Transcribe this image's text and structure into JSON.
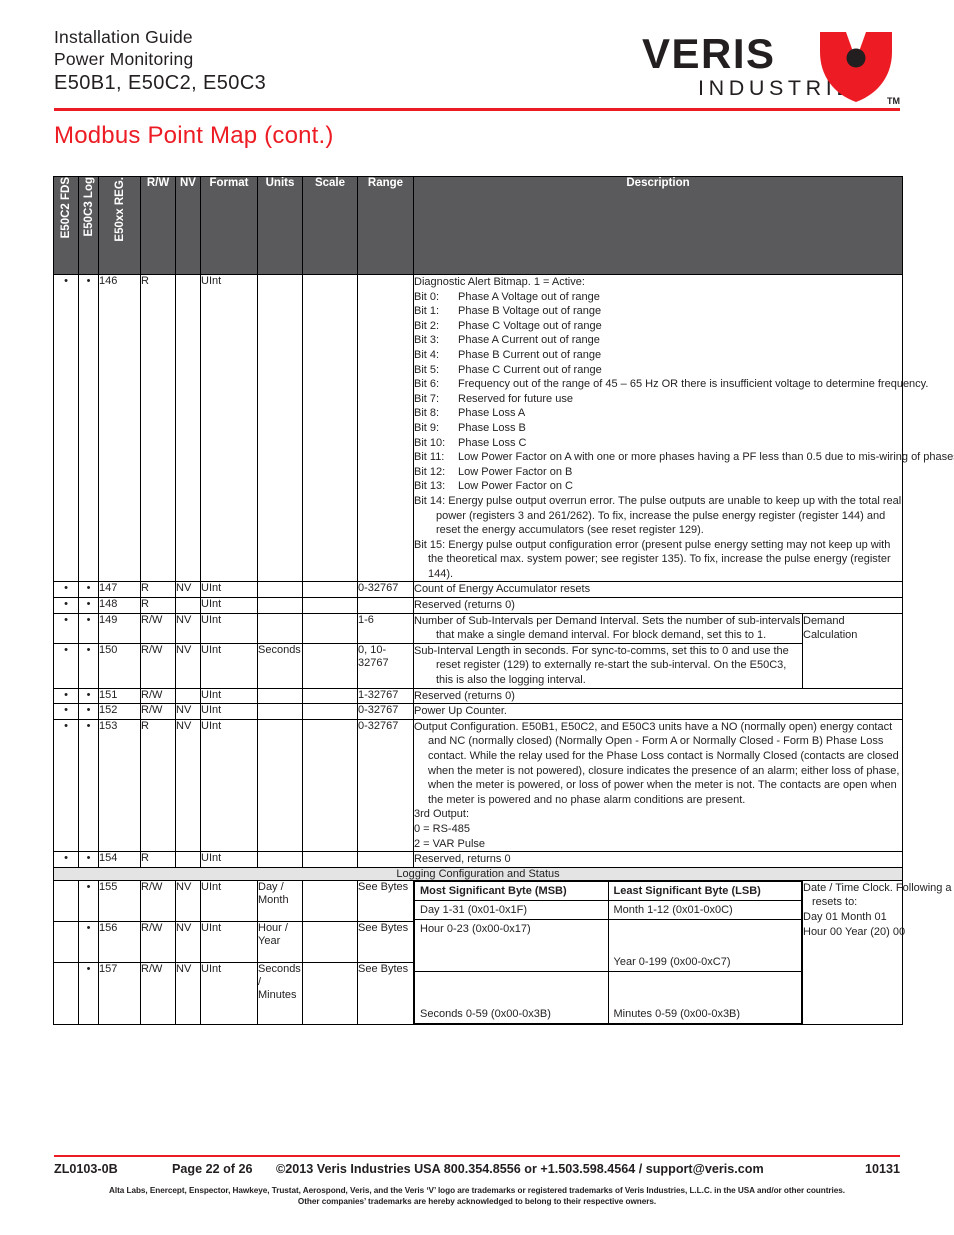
{
  "header": {
    "line1": "Installation Guide",
    "line2": "Power Monitoring",
    "line3": "E50B1, E50C2, E50C3",
    "logo_name": "VERIS",
    "logo_sub": "INDUSTRIES",
    "logo_tm": "TM",
    "page_title": "Modbus Point Map (cont.)"
  },
  "colors": {
    "accent_red": "#ed1c24",
    "header_gray": "#5a595b",
    "band_gray": "#e4e4e4",
    "text": "#231f20"
  },
  "table": {
    "columns": [
      "E50C2 FDS",
      "E50C3 Log",
      "E50xx REG.",
      "R/W",
      "NV",
      "Format",
      "Units",
      "Scale",
      "Range",
      "Description"
    ],
    "rows": [
      {
        "fds": "•",
        "log": "•",
        "reg": "146",
        "rw": "R",
        "nv": "",
        "format": "UInt",
        "units": "",
        "scale": "",
        "range": "",
        "desc_title": "Diagnostic Alert Bitmap. 1 = Active:",
        "bits": [
          {
            "label": "Bit 0:",
            "text": "Phase A Voltage out of range"
          },
          {
            "label": "Bit 1:",
            "text": "Phase B Voltage out of range"
          },
          {
            "label": "Bit 2:",
            "text": "Phase C Voltage out of range"
          },
          {
            "label": "Bit 3:",
            "text": "Phase A Current out of range"
          },
          {
            "label": "Bit 4:",
            "text": "Phase B Current out of range"
          },
          {
            "label": "Bit 5:",
            "text": "Phase C Current out of range"
          },
          {
            "label": "Bit 6:",
            "text": "Frequency out of the range of 45 – 65 Hz OR there is insufficient voltage to determine frequency."
          },
          {
            "label": "Bit 7:",
            "text": "Reserved for future use"
          },
          {
            "label": "Bit 8:",
            "text": "Phase Loss A"
          },
          {
            "label": "Bit 9:",
            "text": "Phase Loss B"
          },
          {
            "label": "Bit 10:",
            "text": "Phase Loss C"
          },
          {
            "label": "Bit 11:",
            "text": "Low Power Factor on A with one or more phases having a PF less than 0.5 due to mis-wiring of phases"
          },
          {
            "label": "Bit 12:",
            "text": "Low Power Factor on B"
          },
          {
            "label": "Bit 13:",
            "text": "Low Power Factor on C"
          }
        ],
        "bit14": "Bit 14:  Energy pulse output overrun error. The pulse outputs are unable to keep up with the total real power (registers 3 and 261/262). To fix, increase the pulse energy register (register 144) and reset the energy accumulators (see reset register 129).",
        "bit15": "Bit 15:  Energy pulse output configuration error (present pulse energy setting may not keep up with the theoretical max. system power; see register 135). To fix, increase the pulse energy (register 144)."
      },
      {
        "fds": "•",
        "log": "•",
        "reg": "147",
        "rw": "R",
        "nv": "NV",
        "format": "UInt",
        "units": "",
        "scale": "",
        "range": "0-32767",
        "desc": "Count of Energy Accumulator resets"
      },
      {
        "fds": "•",
        "log": "•",
        "reg": "148",
        "rw": "R",
        "nv": "",
        "format": "UInt",
        "units": "",
        "scale": "",
        "range": "",
        "desc": "Reserved (returns 0)"
      },
      {
        "fds": "•",
        "log": "•",
        "reg": "149",
        "rw": "R/W",
        "nv": "NV",
        "format": "UInt",
        "units": "",
        "scale": "",
        "range": "1-6",
        "desc": "Number of Sub-Intervals per Demand Interval. Sets the number of sub-intervals that make a single demand interval. For block demand, set this to 1.",
        "group": "Demand Calculation"
      },
      {
        "fds": "•",
        "log": "•",
        "reg": "150",
        "rw": "R/W",
        "nv": "NV",
        "format": "UInt",
        "units": "Seconds",
        "scale": "",
        "range": "0, 10-32767",
        "desc": "Sub-Interval Length in seconds. For sync-to-comms, set this to 0 and use the reset register (129) to externally re-start the sub-interval. On the E50C3, this is also the logging interval."
      },
      {
        "fds": "•",
        "log": "•",
        "reg": "151",
        "rw": "R/W",
        "nv": "",
        "format": "UInt",
        "units": "",
        "scale": "",
        "range": "1-32767",
        "desc": "Reserved (returns 0)"
      },
      {
        "fds": "•",
        "log": "•",
        "reg": "152",
        "rw": "R/W",
        "nv": "NV",
        "format": "UInt",
        "units": "",
        "scale": "",
        "range": "0-32767",
        "desc": "Power Up Counter."
      },
      {
        "fds": "•",
        "log": "•",
        "reg": "153",
        "rw": "R",
        "nv": "NV",
        "format": "UInt",
        "units": "",
        "scale": "",
        "range": "0-32767",
        "desc_p1": "Output Configuration. E50B1, E50C2, and E50C3 units have a NO (normally open) energy contact and NC (normally closed) (Normally Open - Form A or Normally Closed - Form B) Phase Loss contact. While the relay used for the Phase Loss contact is Normally Closed (contacts are closed when the meter is not powered), closure indicates the presence of an alarm; either loss of phase, when the meter is powered, or loss of power when the meter is not. The contacts are open when the meter is powered and no phase alarm conditions are present.",
        "desc_p2": "3rd Output:",
        "desc_p3": "0 = RS-485",
        "desc_p4": "2 = VAR Pulse"
      },
      {
        "fds": "•",
        "log": "•",
        "reg": "154",
        "rw": "R",
        "nv": "",
        "format": "UInt",
        "units": "",
        "scale": "",
        "range": "",
        "desc": "Reserved, returns 0"
      }
    ],
    "band_label": "Logging Configuration and Status",
    "byte_headers": {
      "msb": "Most Significant Byte (MSB)",
      "lsb": "Least Significant Byte (LSB)"
    },
    "clock_rows": [
      {
        "fds": "",
        "log": "•",
        "reg": "155",
        "rw": "R/W",
        "nv": "NV",
        "format": "UInt",
        "units": "Day / Month",
        "units_l1": "Day /",
        "units_l2": "Month",
        "scale": "",
        "range": "See Bytes",
        "msb": "Day 1-31 (0x01-0x1F)",
        "lsb": "Month 1-12 (0x01-0x0C)"
      },
      {
        "fds": "",
        "log": "•",
        "reg": "156",
        "rw": "R/W",
        "nv": "NV",
        "format": "UInt",
        "units": "Hour / Year",
        "units_l1": "Hour /",
        "units_l2": "Year",
        "scale": "",
        "range": "See Bytes",
        "msb": "Hour 0-23 (0x00-0x17)",
        "lsb": "Year 0-199 (0x00-0xC7)"
      },
      {
        "fds": "",
        "log": "•",
        "reg": "157",
        "rw": "R/W",
        "nv": "NV",
        "format": "UInt",
        "units": "Seconds / Minutes",
        "units_l1": "Seconds /",
        "units_l2": "Minutes",
        "scale": "",
        "range": "See Bytes",
        "msb": "Seconds 0-59 (0x00-0x3B)",
        "lsb": "Minutes 0-59 (0x00-0x3B)"
      }
    ],
    "clock_note_l1": "Date / Time Clock. Following a power cycle,",
    "clock_note_l2": "resets to:",
    "clock_note_l3": "Day  01        Month    01",
    "clock_note_l4": "Hour 00      Year    (20) 00"
  },
  "footer": {
    "doc_number": "ZL0103-0B",
    "page": "Page 22 of 26",
    "copyright": "©2013 Veris Industries  USA 800.354.8556 or +1.503.598.4564 / support@veris.com",
    "code": "10131",
    "fine1": "Alta Labs, Enercept, Enspector, Hawkeye, Trustat, Aerospond, Veris, and the Veris ‘V’ logo are trademarks or registered trademarks of  Veris Industries, L.L.C. in the USA and/or other countries.",
    "fine2": "Other companies’ trademarks are hereby acknowledged to belong to their respective owners."
  }
}
